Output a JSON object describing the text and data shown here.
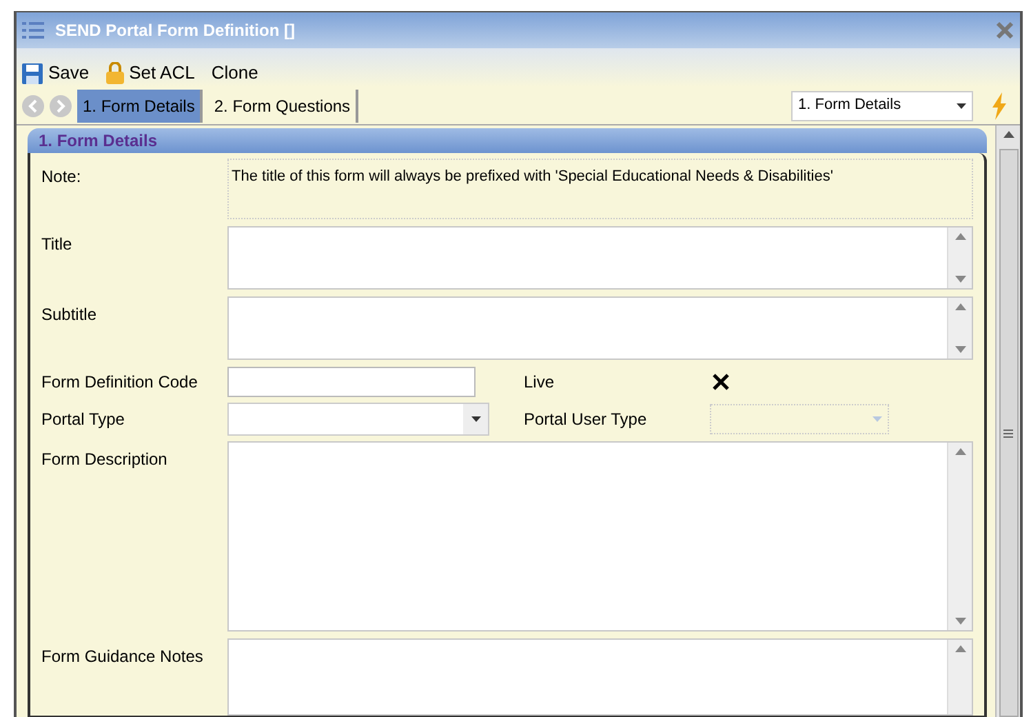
{
  "window": {
    "title": "SEND Portal Form Definition []"
  },
  "toolbar": [
    {
      "label": "Save"
    },
    {
      "label": "Set ACL"
    },
    {
      "label": "Clone"
    }
  ],
  "tabs": [
    {
      "label": "1. Form Details",
      "selected": true
    },
    {
      "label": "2. Form Questions",
      "selected": false
    }
  ],
  "section_select": {
    "value": "1. Form Details"
  },
  "section": {
    "title": "1. Form Details"
  },
  "note": {
    "label": "Note:",
    "text": "The title of this form will always be prefixed with 'Special Educational Needs & Disabilities'"
  },
  "fields": [
    {
      "kind": "textarea",
      "label": "Title"
    },
    {
      "kind": "textarea",
      "label": "Subtitle"
    },
    {
      "kind": "textinput",
      "label": "Form Definition Code",
      "label2": "Live",
      "checked": true
    },
    {
      "kind": "dropdown",
      "label": "Portal Type",
      "label2": "Portal User Type",
      "disabled": true
    },
    {
      "kind": "textarea",
      "label": "Form Description"
    },
    {
      "kind": "textarea",
      "label": "Form Guidance Notes"
    }
  ]
}
